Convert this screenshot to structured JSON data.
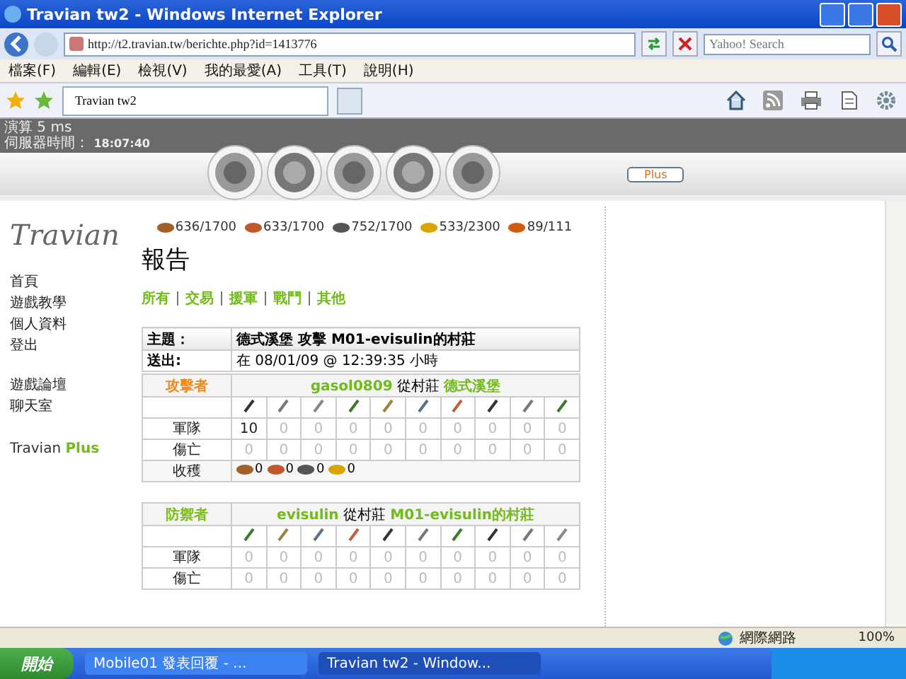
{
  "window": {
    "title": "Travian tw2 - Windows Internet Explorer"
  },
  "address_bar": {
    "url": "http://t2.travian.tw/berichte.php?id=1413776",
    "search_placeholder": "Yahoo! Search"
  },
  "menu": [
    "檔案(F)",
    "編輯(E)",
    "檢視(V)",
    "我的最愛(A)",
    "工具(T)",
    "說明(H)"
  ],
  "tabs": [
    {
      "label": "Travian tw2",
      "selected": true
    }
  ],
  "server_info": {
    "calc": "演算 5 ms",
    "time_label": "伺服器時間：",
    "time": "18:07:40"
  },
  "plus_button": "Plus",
  "sidebar": {
    "logo": "Travian",
    "groups": [
      [
        "首頁",
        "遊戲教學",
        "個人資料",
        "登出"
      ],
      [
        "遊戲論壇",
        "聊天室"
      ]
    ],
    "plus": {
      "text": "Travian",
      "highlight": "Plus"
    }
  },
  "resources": [
    {
      "kind": "wood",
      "text": "636/1700"
    },
    {
      "kind": "clay",
      "text": "633/1700"
    },
    {
      "kind": "iron",
      "text": "752/1700"
    },
    {
      "kind": "crop",
      "text": "533/2300"
    },
    {
      "kind": "upkeep",
      "text": "89/111"
    }
  ],
  "report": {
    "title": "報告",
    "filters": [
      "所有",
      "交易",
      "援軍",
      "戰鬥",
      "其他"
    ],
    "subject_label": "主題：",
    "subject": "德式溪堡 攻擊 M01-evisulin的村莊",
    "sent_label": "送出:",
    "sent": "在 08/01/09 @ 12:39:35 小時",
    "parties": [
      {
        "kind": "attacker",
        "role": "攻擊者",
        "player": "gasol0809",
        "from": "從村莊",
        "village": "德式溪堡",
        "rows": [
          {
            "label": "軍隊",
            "values": [
              {
                "value": "10",
                "dim": false
              },
              {
                "value": "0",
                "dim": true
              },
              {
                "value": "0",
                "dim": true
              },
              {
                "value": "0",
                "dim": true
              },
              {
                "value": "0",
                "dim": true
              },
              {
                "value": "0",
                "dim": true
              },
              {
                "value": "0",
                "dim": true
              },
              {
                "value": "0",
                "dim": true
              },
              {
                "value": "0",
                "dim": true
              },
              {
                "value": "0",
                "dim": true
              }
            ]
          },
          {
            "label": "傷亡",
            "values": [
              {
                "value": "0",
                "dim": true
              },
              {
                "value": "0",
                "dim": true
              },
              {
                "value": "0",
                "dim": true
              },
              {
                "value": "0",
                "dim": true
              },
              {
                "value": "0",
                "dim": true
              },
              {
                "value": "0",
                "dim": true
              },
              {
                "value": "0",
                "dim": true
              },
              {
                "value": "0",
                "dim": true
              },
              {
                "value": "0",
                "dim": true
              },
              {
                "value": "0",
                "dim": true
              }
            ]
          }
        ],
        "bounty": {
          "label": "收穫",
          "values": [
            {
              "kind": "wood",
              "text": "0"
            },
            {
              "kind": "clay",
              "text": "0"
            },
            {
              "kind": "iron",
              "text": "0"
            },
            {
              "kind": "crop",
              "text": "0"
            }
          ]
        }
      },
      {
        "kind": "defender",
        "role": "防禦者",
        "player": "evisulin",
        "from": "從村莊",
        "village": "M01-evisulin的村莊",
        "rows": [
          {
            "label": "軍隊",
            "values": [
              {
                "value": "0",
                "dim": true
              },
              {
                "value": "0",
                "dim": true
              },
              {
                "value": "0",
                "dim": true
              },
              {
                "value": "0",
                "dim": true
              },
              {
                "value": "0",
                "dim": true
              },
              {
                "value": "0",
                "dim": true
              },
              {
                "value": "0",
                "dim": true
              },
              {
                "value": "0",
                "dim": true
              },
              {
                "value": "0",
                "dim": true
              },
              {
                "value": "0",
                "dim": true
              }
            ]
          },
          {
            "label": "傷亡",
            "values": [
              {
                "value": "0",
                "dim": true
              },
              {
                "value": "0",
                "dim": true
              },
              {
                "value": "0",
                "dim": true
              },
              {
                "value": "0",
                "dim": true
              },
              {
                "value": "0",
                "dim": true
              },
              {
                "value": "0",
                "dim": true
              },
              {
                "value": "0",
                "dim": true
              },
              {
                "value": "0",
                "dim": true
              },
              {
                "value": "0",
                "dim": true
              },
              {
                "value": "0",
                "dim": true
              }
            ]
          }
        ]
      }
    ]
  },
  "status_bar": {
    "zone": "網際網路",
    "zoom": "100%"
  },
  "taskbar": {
    "start": "開始",
    "windows": [
      {
        "label": "Mobile01 發表回覆 - ...",
        "selected": false
      },
      {
        "label": "Travian tw2 - Window...",
        "selected": true
      }
    ]
  }
}
